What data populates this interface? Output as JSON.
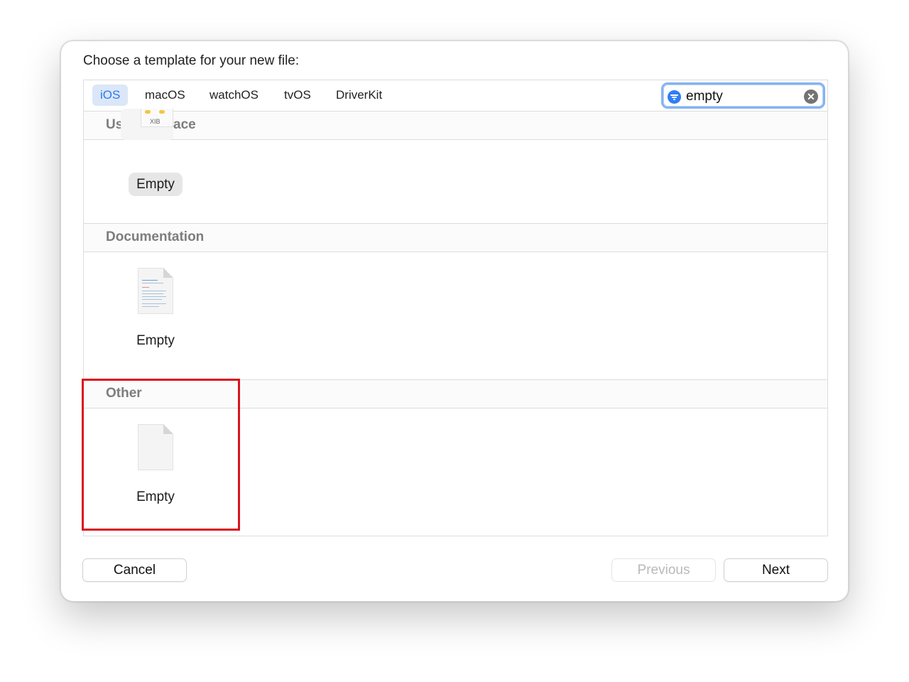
{
  "dialog": {
    "title": "Choose a template for your new file:"
  },
  "platform_tabs": [
    {
      "label": "iOS",
      "active": true
    },
    {
      "label": "macOS",
      "active": false
    },
    {
      "label": "watchOS",
      "active": false
    },
    {
      "label": "tvOS",
      "active": false
    },
    {
      "label": "DriverKit",
      "active": false
    }
  ],
  "search": {
    "value": "empty",
    "filter_icon": "filter-icon",
    "clear_icon": "clear-icon"
  },
  "sections": [
    {
      "title": "User Interface",
      "templates": [
        {
          "label": "Empty",
          "icon": "xib-file-icon",
          "icon_text": "XIB",
          "selected": true
        }
      ]
    },
    {
      "title": "Documentation",
      "templates": [
        {
          "label": "Empty",
          "icon": "documentation-file-icon",
          "selected": false
        }
      ]
    },
    {
      "title": "Other",
      "templates": [
        {
          "label": "Empty",
          "icon": "empty-file-icon",
          "selected": false
        }
      ]
    }
  ],
  "buttons": {
    "cancel": "Cancel",
    "previous": "Previous",
    "next": "Next"
  },
  "colors": {
    "accent": "#2a7af0",
    "active_tab_bg": "#dbe7f8",
    "highlight_box": "#d9141c",
    "section_title": "#7d7d7d"
  }
}
